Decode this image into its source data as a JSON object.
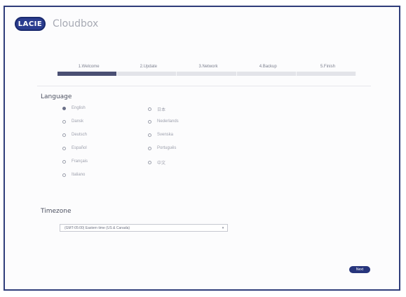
{
  "header": {
    "logo_text": "LACIE",
    "app_name": "Cloudbox"
  },
  "colors": {
    "brand": "#2b3d8f",
    "frame_border": "#2f3d7a",
    "active_step": "#4a4f73",
    "next_button": "#27357c"
  },
  "stepper": {
    "active_index": 0,
    "steps": [
      {
        "label": "1.Welcome"
      },
      {
        "label": "2.Update"
      },
      {
        "label": "3.Network"
      },
      {
        "label": "4.Backup"
      },
      {
        "label": "5.Finish"
      }
    ]
  },
  "language": {
    "title": "Language",
    "selected": "English",
    "options": [
      {
        "label": "English"
      },
      {
        "label": "Dansk"
      },
      {
        "label": "Deutsch"
      },
      {
        "label": "Español"
      },
      {
        "label": "Français"
      },
      {
        "label": "Italiano"
      },
      {
        "label": "日本"
      },
      {
        "label": "Nederlands"
      },
      {
        "label": "Svenska"
      },
      {
        "label": "Português"
      },
      {
        "label": "中文"
      }
    ]
  },
  "timezone": {
    "title": "Timezone",
    "value": "(GMT-05:00) Eastern time (US & Canada)"
  },
  "actions": {
    "next_label": "Next"
  }
}
